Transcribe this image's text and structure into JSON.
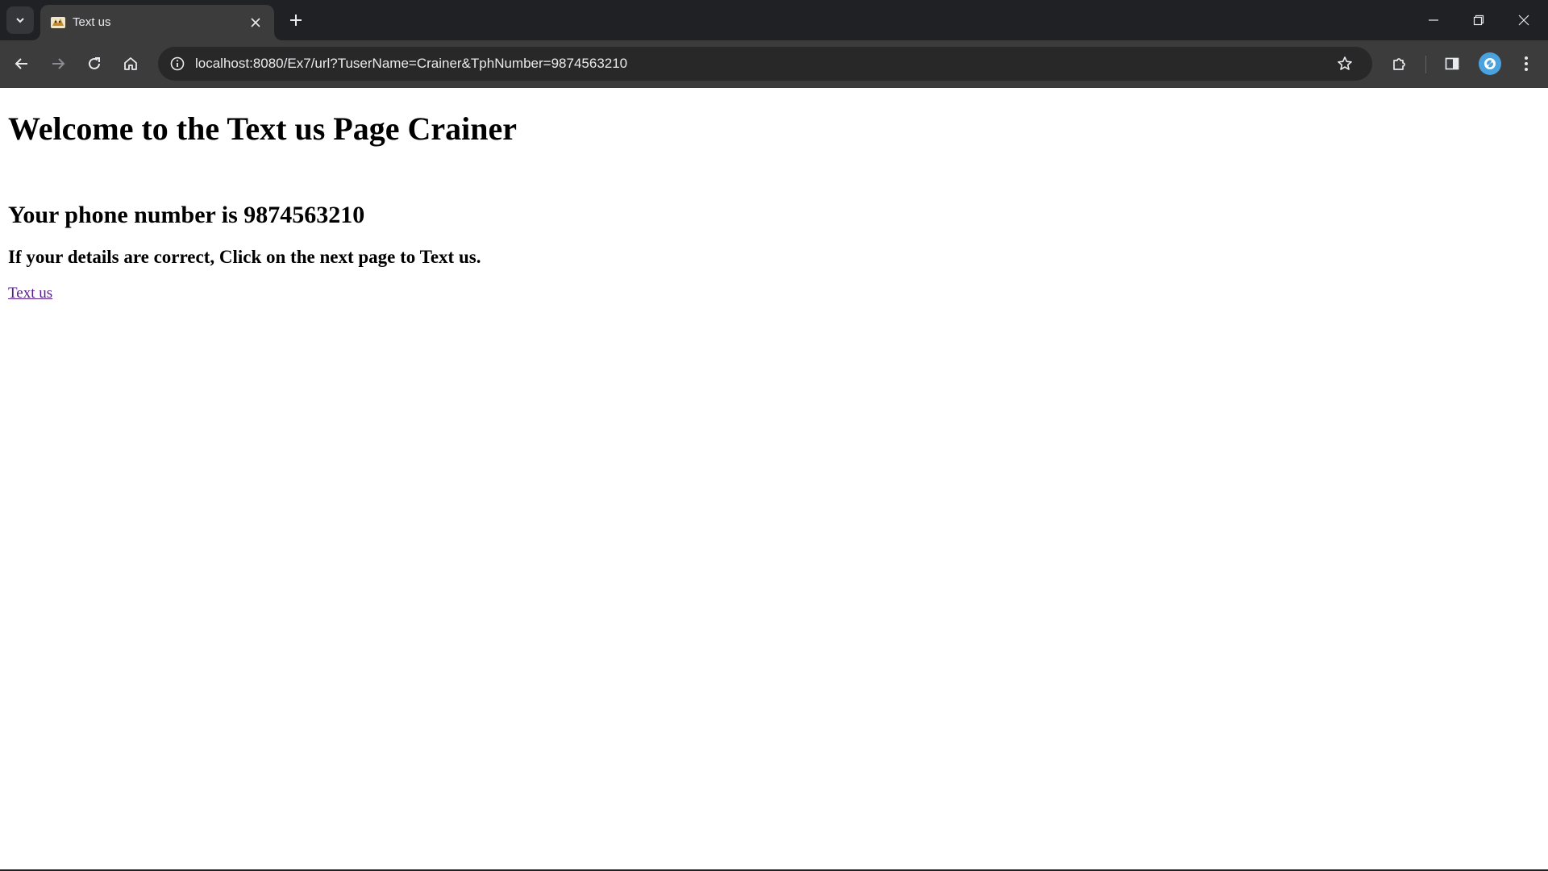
{
  "browser": {
    "tab": {
      "title": "Text us",
      "favicon": "tomcat-favicon-icon"
    },
    "url": "localhost:8080/Ex7/url?TuserName=Crainer&TphNumber=9874563210",
    "icons": {
      "tab_search": "chevron-down-icon",
      "tab_close": "close-icon",
      "new_tab": "plus-icon",
      "back": "back-arrow-icon",
      "forward": "forward-arrow-icon",
      "reload": "reload-icon",
      "home": "home-icon",
      "site_info": "info-icon",
      "bookmark": "star-icon",
      "extensions": "puzzle-icon",
      "side_panel": "side-panel-icon",
      "profile": "profile-avatar-icon",
      "menu": "more-vert-icon"
    }
  },
  "page": {
    "heading": "Welcome to the Text us Page Crainer",
    "phone_line": "Your phone number is 9874563210",
    "instruction": "If your details are correct, Click on the next page to Text us.",
    "link_label": "Text us"
  },
  "colors": {
    "tabstrip_bg": "#202124",
    "toolbar_bg": "#3c3c3c",
    "omnibox_bg": "#282828",
    "visited_link": "#551a8b",
    "avatar": "#4aa3df"
  }
}
